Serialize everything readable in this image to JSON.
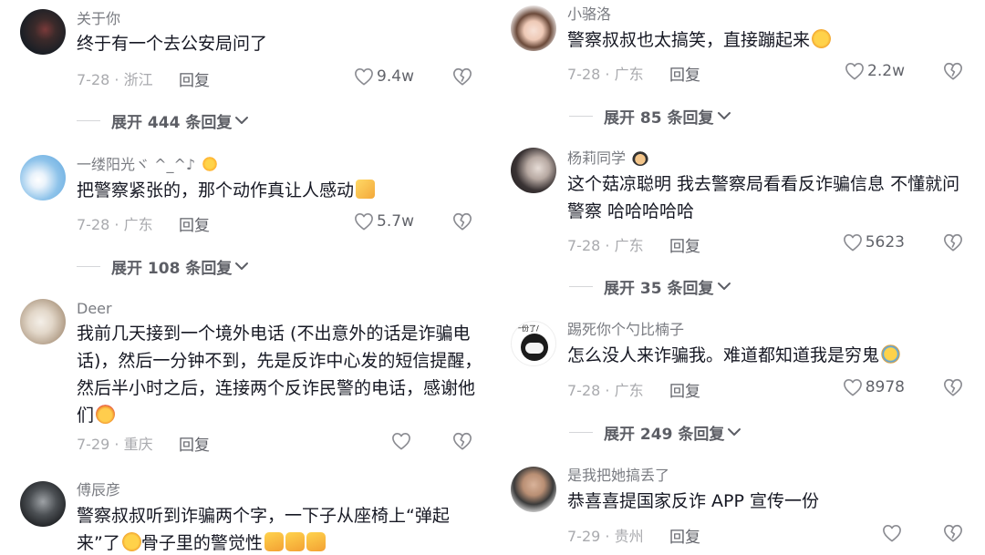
{
  "comments_left": [
    {
      "username": "关于你",
      "text": "终于有一个去公安局问了",
      "date": "7-28 · 浙江",
      "reply": "回复",
      "likes": "9.4w",
      "expand": "展开 444 条回复"
    },
    {
      "username": "一缕阳光ヾ ^_^♪",
      "text": "把警察紧张的，那个动作真让人感动",
      "date": "7-28 · 广东",
      "reply": "回复",
      "likes": "5.7w",
      "expand": "展开 108 条回复"
    },
    {
      "username": "Deer",
      "text": "我前几天接到一个境外电话 (不出意外的话是诈骗电话)，然后一分钟不到，先是反诈中心发的短信提醒，然后半小时之后，连接两个反诈民警的电话，感谢他们",
      "date": "7-29 · 重庆",
      "reply": "回复",
      "likes": ""
    },
    {
      "username": "傅辰彦",
      "text": "警察叔叔听到诈骗两个字，一下子从座椅上“弹起来”了",
      "text_tail": "骨子里的警觉性"
    }
  ],
  "comments_right": [
    {
      "username": "小骆洛",
      "text": "警察叔叔也太搞笑，直接蹦起来",
      "date": "7-28 · 广东",
      "reply": "回复",
      "likes": "2.2w",
      "expand": "展开 85 条回复"
    },
    {
      "username": "杨莉同学",
      "text": "这个菇凉聪明 我去警察局看看反诈骗信息 不懂就问警察 哈哈哈哈哈",
      "date": "7-28 · 广东",
      "reply": "回复",
      "likes": "5623",
      "expand": "展开 35 条回复"
    },
    {
      "username": "踢死你个勺比楠子",
      "text": "怎么没人来诈骗我。难道都知道我是穷鬼",
      "date": "7-28 · 广东",
      "reply": "回复",
      "likes": "8978",
      "expand": "展开 249 条回复"
    },
    {
      "username": "是我把她搞丢了",
      "text": "恭喜喜提国家反诈 APP 宣传一份",
      "date": "7-29 · 贵州",
      "reply": "回复",
      "likes": ""
    }
  ],
  "avatar_sticker_text": "一份了/",
  "colors": {
    "text": "#161823",
    "muted": "#a9aaae",
    "username": "#7a7c82",
    "action": "#61636a"
  },
  "icons": [
    "heart-outline-icon",
    "broken-heart-icon",
    "chevron-down-icon"
  ]
}
